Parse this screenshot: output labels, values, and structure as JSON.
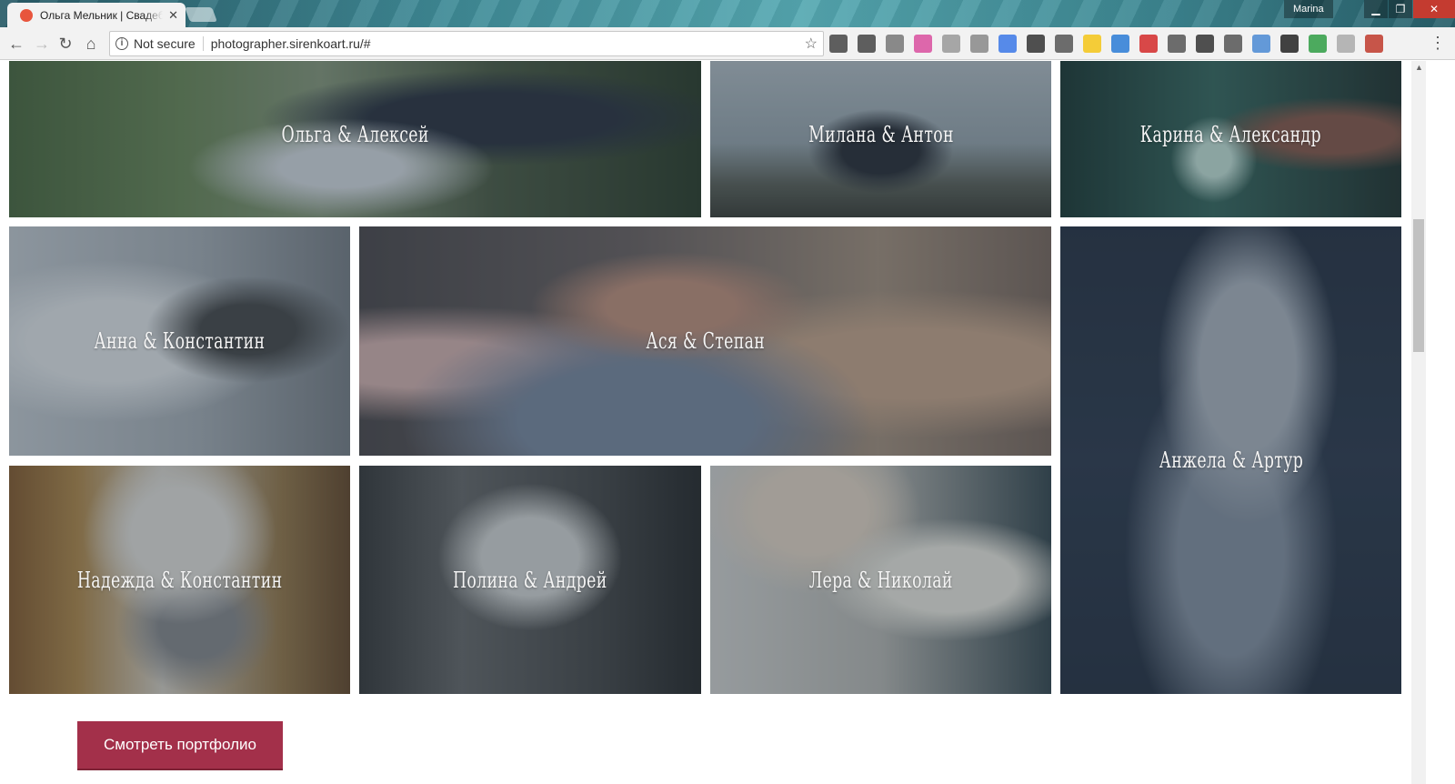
{
  "browser": {
    "tab_title": "Ольга Мельник | Свадебный фотограф",
    "tab_close": "✕",
    "profile_name": "Marina",
    "security_label": "Not secure",
    "url": "photographer.sirenkoart.ru/#",
    "window_buttons": {
      "minimize": "▁",
      "restore": "❐",
      "close": "✕"
    },
    "extension_icons": [
      "screenshot-icon",
      "formula-icon",
      "settings-ext-icon",
      "color-ext-icon",
      "layout-ext-icon",
      "hat-ext-icon",
      "translate-ext-icon",
      "eyedropper-ext-icon",
      "ruler-ext-icon",
      "note-ext-icon",
      "window-ext-icon",
      "pepper-ext-icon",
      "triangle-ext-icon",
      "dots-ext-icon",
      "move-ext-icon",
      "image-ext-icon",
      "check-ext-icon",
      "seo-ext-icon",
      "face-ext-icon",
      "code-ext-icon"
    ],
    "extension_colors": [
      "#444444",
      "#444444",
      "#777777",
      "#d94f9f",
      "#999999",
      "#888888",
      "#3b78e7",
      "#333333",
      "#555555",
      "#f5c518",
      "#2a7bd6",
      "#d42a2a",
      "#555555",
      "#333333",
      "#555555",
      "#4a8ad4",
      "#222222",
      "#2f9e44",
      "#aaaaaa",
      "#c0392b"
    ]
  },
  "gallery": {
    "items": [
      {
        "name": "Ольга & Алексей"
      },
      {
        "name": "Милана & Антон"
      },
      {
        "name": "Карина & Александр"
      },
      {
        "name": "Анна & Константин"
      },
      {
        "name": "Ася & Степан"
      },
      {
        "name": "Анжела & Артур"
      },
      {
        "name": "Надежда & Константин"
      },
      {
        "name": "Полина & Андрей"
      },
      {
        "name": "Лера & Николай"
      }
    ]
  },
  "cta": {
    "label": "Смотреть портфолио",
    "color": "#a3304a"
  }
}
